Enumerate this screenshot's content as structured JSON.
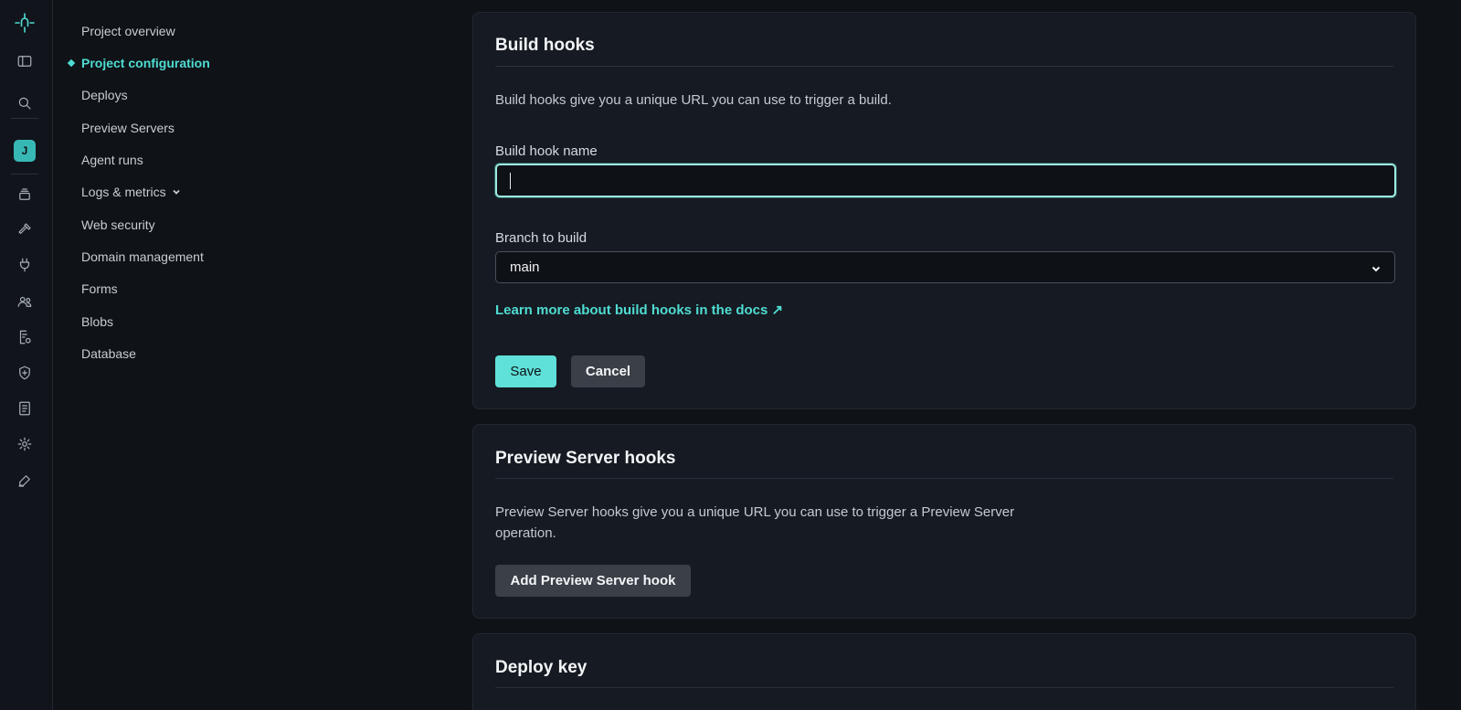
{
  "rail": {
    "avatar_initial": "J"
  },
  "sidenav": {
    "items": [
      {
        "label": "Project overview"
      },
      {
        "label": "Project configuration",
        "active": true
      },
      {
        "label": "Deploys"
      },
      {
        "label": "Preview Servers"
      },
      {
        "label": "Agent runs"
      },
      {
        "label": "Logs & metrics"
      },
      {
        "label": "Web security"
      },
      {
        "label": "Domain management"
      },
      {
        "label": "Forms"
      },
      {
        "label": "Blobs"
      },
      {
        "label": "Database"
      }
    ]
  },
  "build_hooks": {
    "title": "Build hooks",
    "description": "Build hooks give you a unique URL you can use to trigger a build.",
    "name_label": "Build hook name",
    "name_value": "",
    "branch_label": "Branch to build",
    "branch_value": "main",
    "docs_link": "Learn more about build hooks in the docs ↗",
    "save_label": "Save",
    "cancel_label": "Cancel"
  },
  "preview_hooks": {
    "title": "Preview Server hooks",
    "description": "Preview Server hooks give you a unique URL you can use to trigger a Preview Server operation.",
    "add_label": "Add Preview Server hook"
  },
  "deploy_key": {
    "title": "Deploy key"
  },
  "colors": {
    "accent": "#4fdcd2",
    "background": "#0f1217",
    "card": "#161a22"
  }
}
